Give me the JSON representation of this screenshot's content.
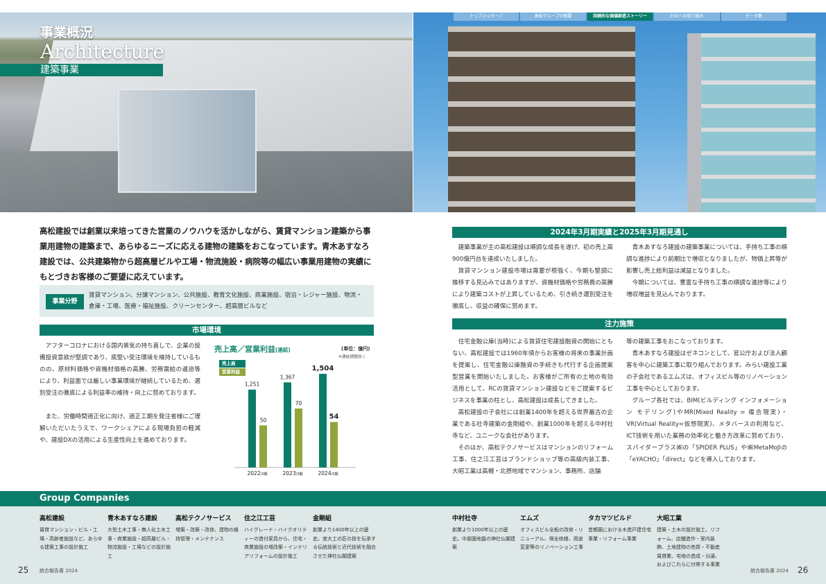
{
  "nav": {
    "tabs": [
      "トップメッセージ",
      "高松グループの概要",
      "持続的な価値創造ストーリー",
      "ESGへの取り組み",
      "データ集"
    ],
    "active_index": 2
  },
  "header": {
    "title_jp": "事業概況",
    "title_en": "Architecture",
    "subtitle": "建築事業"
  },
  "lead": "高松建設では創業以来培ってきた営業のノウハウを活かしながら、賃貸マンション建築から事業用建物の建築まで、あらゆるニーズに応える建物の建築をおこなっています。青木あすなろ建設では、公共建築物から超高層ビルや工場・物流施設・病院等の幅広い事業用建物の実績にもとづきお客様のご要望に応えています。",
  "business_field": {
    "label": "事業分野",
    "text": "賃貸マンション、分譲マンション、公共施設、教育文化施設、商業施設、宿泊・レジャー施設、物流・倉庫・工場、医療・福祉施設、クリーンセンター、超高層ビルなど"
  },
  "market": {
    "heading": "市場環境",
    "p1": "アフターコロナにおける国内景気の持ち直しで、企業の設備投資意欲が堅調であり、底堅い受注環境を維持しているものの、原材料価格や資機材価格の高騰、労務需給の逼迫等により、利益面では厳しい事業環境が継続しているため、選別受注の徹底による利益率の維持・向上に努めております。",
    "p2": "また、労働時間適正化に向け、適正工期を発注者様にご理解いただいたうえで、ワークシェアによる現場負担の軽減や、建設DXの活用による生産性向上を進めております。"
  },
  "chart_data": {
    "type": "bar",
    "title": "売上高／営業利益",
    "title_suffix": "(連結)",
    "unit": "(単位：億円)",
    "note": "※連結調整除く",
    "categories": [
      "2022/3期",
      "2023/3期",
      "2024/3期"
    ],
    "category_labels": [
      {
        "year": "2022",
        "suffix": "/3期"
      },
      {
        "year": "2023",
        "suffix": "/3期"
      },
      {
        "year": "2024",
        "suffix": "/3期"
      }
    ],
    "series": [
      {
        "name": "売上高",
        "values": [
          1251,
          1367,
          1504
        ],
        "value_labels": [
          "1,251",
          "1,367",
          "1,504"
        ],
        "color": "#0b7c6a"
      },
      {
        "name": "営業利益",
        "values": [
          50,
          70,
          54
        ],
        "value_labels": [
          "50",
          "70",
          "54"
        ],
        "color": "#8fa63f"
      }
    ]
  },
  "results": {
    "heading": "2024年3月期実績と2025年3月期見通し",
    "col1_p1": "建築事業が主の高松建設は順調な成長を遂げ、初の売上高900億円台を達成いたしました。",
    "col1_p2": "賃貸マンション建設市場は需要が根強く、今期も堅調に推移する見込みではありますが、資機材価格や労務費の高騰により建築コストが上昇しているため、引き続き選別受注を徹底し、収益の確保に努めます。",
    "col2_p1": "青木あすなろ建設の建築事業については、手持ち工事の順調な進捗により前期比で増収となりましたが、物価上昇等が影響し売上総利益は減益となりました。",
    "col2_p2": "今期については、豊富な手持ち工事の順調な進捗等により増収増益を見込んでおります。"
  },
  "focus": {
    "heading": "注力施策",
    "col1_p1": "住宅金融公庫(当時)による賃貸住宅建設融資の開始にともない、高松建設では1960年頃からお客様の将来の事業計画を提案し、住宅金融公庫融資の手続きも代行する企画提案型営業を開始いたしました。お客様がご所有の土地の有効活用として、RCの賃貸マンション建設などをご提案するビジネスを事業の柱とし、高松建設は成長してきました。",
    "col1_p2": "高松建設の子会社には創業1400年を超える世界最古の企業である社寺建築の金剛組や、創業1000年を超える中村社寺など、ユニークな会社があります。",
    "col1_p3": "そのほか、高松テクノサービスはマンションのリフォーム工事、住之江工芸はブランドショップ等の高級内装工事、大昭工業は高槻・北摂地域でマンション、事務所、店舗",
    "col2_p1": "等の建築工事をおこなっております。",
    "col2_p2": "青木あすなろ建設はゼネコンとして、官公庁および法人顧客を中心に建築工事に取り組んでおります。みらい建設工業の子会社であるエムズは、オフィスビル等のリノベーション工事を中心としております。",
    "col2_p3": "グループ各社では、BIM(ビルディング インフォメーション モデリング)やMR(Mixed Reality = 複合現実)・VR(Virtual Reality=仮想現実)、メタバースの利用など、ICT技術を用いた業務の効率化と働き方改革に努めており、スパイダープラス㈱の「SPIDER PLUS」や㈱MetaMoJIの「eYACHO」「direct」などを導入しております。"
  },
  "group": {
    "title": "Group Companies",
    "companies": [
      {
        "name": "高松建設",
        "desc": "賃貸マンション・ビル・工場・高齢者施設など、あらゆる建築工事の設計施工"
      },
      {
        "name": "青木あすなろ建設",
        "desc": "大型土木工事・無人化土木工事・商業施設・超高層ビル・物流施設・工場などの設計施工"
      },
      {
        "name": "高松テクノサービス",
        "desc": "増築・改築・改修、建物の維持管理・メンテナンス"
      },
      {
        "name": "住之江工芸",
        "desc": "ハイグレード・ハイクオリティーの造付家具から、住宅・商業施設の増改築・インテリアリフォームの設計施工"
      },
      {
        "name": "金剛組",
        "desc": "創業より1400年以上の歴史。宮大工の匠の技を伝承する伝統技術と近代技術を融合させた神社仏閣建築"
      },
      {
        "name": "中村社寺",
        "desc": "創業より1000年以上の歴史。中部圏地盤の神社仏閣建築"
      },
      {
        "name": "エムズ",
        "desc": "オフィスビル全般の改修・リニューアル、保全修繕、用途変更等のリノベーション工事"
      },
      {
        "name": "タカマツビルド",
        "desc": "首都圏における木造戸建住宅事業・リフォーム事業"
      },
      {
        "name": "大昭工業",
        "desc": "建築・土木の設計施工、リフォーム、店舗造作・室内装飾、土地建物の売買・不動産賃貸業、宅地の造成・分譲、およびこれらに付帯する事業"
      }
    ]
  },
  "footer": {
    "left_page": "25",
    "right_page": "26",
    "report": "統合報告書 2024"
  }
}
